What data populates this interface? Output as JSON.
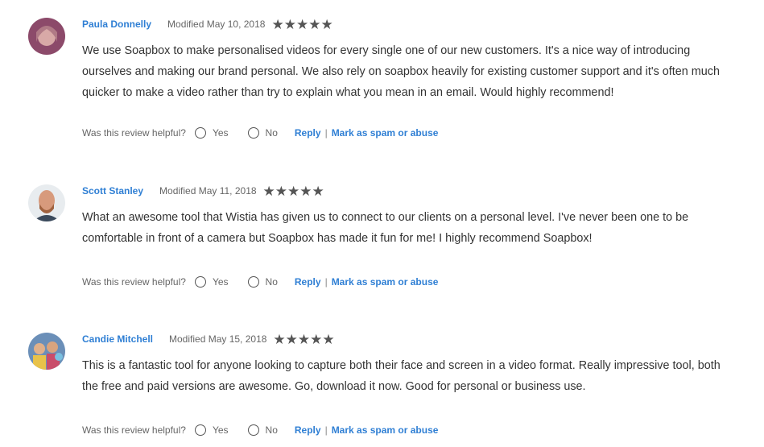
{
  "reviews": [
    {
      "author": "Paula Donnelly",
      "modified": "Modified May 10, 2018",
      "rating": 5,
      "body": "We use Soapbox to make personalised videos for every single one of our new customers.  It's a nice way of introducing ourselves and making our brand personal.  We also rely on soapbox heavily for existing customer support and it's often much quicker to make a video rather than try to explain what you mean in an email.  Would highly recommend!",
      "helpful_prompt": "Was this review helpful?",
      "yes_label": "Yes",
      "no_label": "No",
      "reply_label": "Reply",
      "separator": "|",
      "spam_label": "Mark as spam or abuse"
    },
    {
      "author": "Scott Stanley",
      "modified": "Modified May 11, 2018",
      "rating": 5,
      "body": "What an awesome tool that Wistia has given us to connect to our clients on a personal level. I've never been one to be comfortable in front of a camera but Soapbox has made it fun for me! I highly recommend Soapbox!",
      "helpful_prompt": "Was this review helpful?",
      "yes_label": "Yes",
      "no_label": "No",
      "reply_label": "Reply",
      "separator": "|",
      "spam_label": "Mark as spam or abuse"
    },
    {
      "author": "Candie Mitchell",
      "modified": "Modified May 15, 2018",
      "rating": 5,
      "body": "This is a fantastic tool for anyone looking to capture both their face and screen in a video format. Really impressive tool, both the free and paid versions are awesome. Go, download it now. Good for personal or business use.",
      "helpful_prompt": "Was this review helpful?",
      "yes_label": "Yes",
      "no_label": "No",
      "reply_label": "Reply",
      "separator": "|",
      "spam_label": "Mark as spam or abuse"
    }
  ],
  "colors": {
    "link": "#2f7fd4",
    "star": "#555555",
    "text": "#333333"
  },
  "icons": {
    "star": "star-icon",
    "radio": "radio-button"
  }
}
